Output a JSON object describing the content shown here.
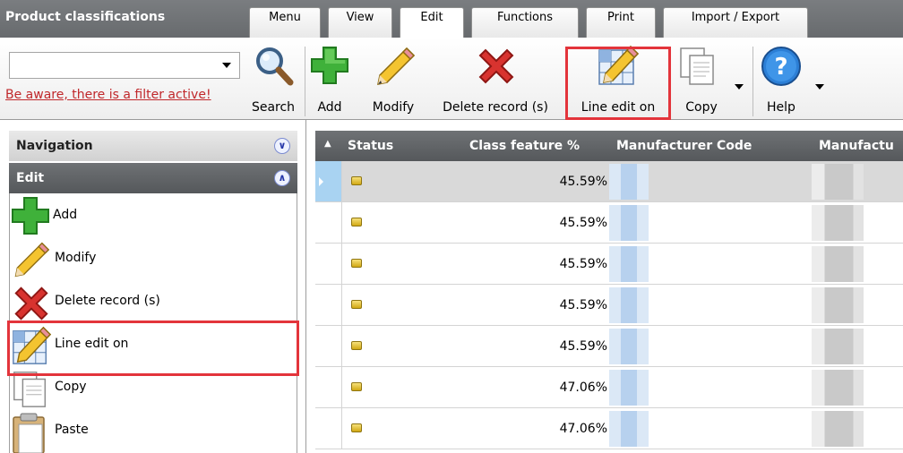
{
  "app_title": "Product classifications",
  "tabs": [
    {
      "label": "Menu"
    },
    {
      "label": "View"
    },
    {
      "label": "Edit"
    },
    {
      "label": "Functions"
    },
    {
      "label": "Print"
    },
    {
      "label": "Import / Export"
    }
  ],
  "active_tab": "Edit",
  "toolbar": {
    "filter_select_value": "",
    "filter_warning": "Be aware, there is a filter active!",
    "search_label": "Search",
    "add_label": "Add",
    "modify_label": "Modify",
    "delete_label": "Delete record (s)",
    "line_edit_label": "Line edit on",
    "copy_label": "Copy",
    "help_label": "Help"
  },
  "nav": {
    "header_navigation": "Navigation",
    "header_edit": "Edit",
    "items": [
      {
        "label": "Add",
        "icon": "plus-icon"
      },
      {
        "label": "Modify",
        "icon": "pencil-icon"
      },
      {
        "label": "Delete record (s)",
        "icon": "delete-x-icon"
      },
      {
        "label": "Line edit on",
        "icon": "line-edit-icon"
      },
      {
        "label": "Copy",
        "icon": "copy-icon"
      },
      {
        "label": "Paste",
        "icon": "paste-icon"
      }
    ]
  },
  "grid": {
    "columns": [
      "Status",
      "Class feature %",
      "Manufacturer Code",
      "Manufactu"
    ],
    "rows": [
      {
        "class_feature_pct": "45.59%"
      },
      {
        "class_feature_pct": "45.59%"
      },
      {
        "class_feature_pct": "45.59%"
      },
      {
        "class_feature_pct": "45.59%"
      },
      {
        "class_feature_pct": "45.59%"
      },
      {
        "class_feature_pct": "47.06%"
      },
      {
        "class_feature_pct": "47.06%"
      }
    ],
    "selected_row": 0
  },
  "colors": {
    "highlight": "#e3343b",
    "warning_text": "#c0282b",
    "header_dark": "#55585b",
    "status_yellow": "#e8c640"
  }
}
